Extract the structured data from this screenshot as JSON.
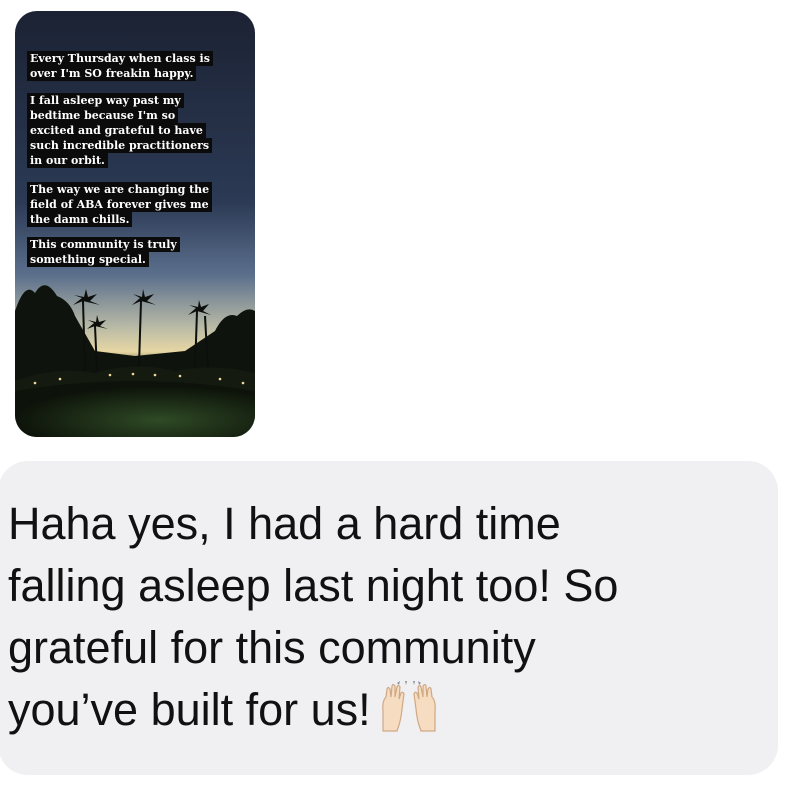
{
  "story": {
    "captions": [
      [
        "Every Thursday when class is",
        "over I'm SO freakin happy."
      ],
      [
        "I fall asleep way past my",
        "bedtime because I'm so",
        "excited and grateful to have",
        "such incredible practitioners",
        "in our orbit."
      ],
      [
        "The way we are changing the",
        "field of ABA forever gives me",
        "the damn chills."
      ],
      [
        "This community is truly",
        "something special."
      ]
    ]
  },
  "message": {
    "lines": [
      "Haha yes, I had a hard time",
      "falling asleep last night too! So",
      "grateful for this community",
      "you’ve built for us!"
    ],
    "emoji": "raising-hands-icon"
  },
  "colors": {
    "bubble": "#f0f0f2",
    "text": "#111111",
    "caption_bg": "#0b0b0b",
    "sky_top": "#1d2536",
    "sky_horizon": "#e9d9a8"
  }
}
